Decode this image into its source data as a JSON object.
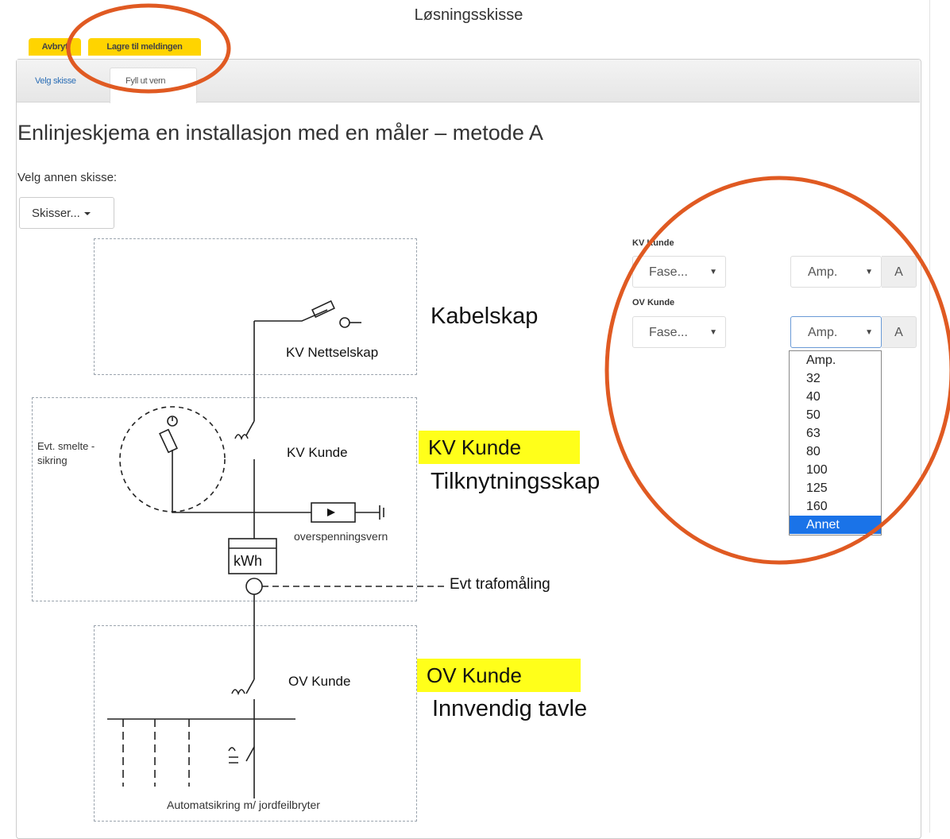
{
  "page_title": "Løsningsskisse",
  "toolbar": {
    "cancel_label": "Avbryt",
    "save_label": "Lagre til meldingen"
  },
  "tabs": [
    {
      "label": "Velg skisse"
    },
    {
      "label": "Fyll ut vern"
    }
  ],
  "heading": "Enlinjeskjema en installasjon med en måler – metode A",
  "choose_other_label": "Velg annen skisse:",
  "sketch_dropdown": {
    "label": "Skisser..."
  },
  "colors": {
    "tab_yellow": "#ffd400",
    "highlight_yellow": "#ffff1a",
    "annotation_orange": "#e05a22",
    "selected_option": "#1a73e8",
    "link_blue": "#2a6db5"
  },
  "form": {
    "kv": {
      "label": "KV Kunde",
      "phase_value": "Fase...",
      "amp_value": "Amp.",
      "unit": "A"
    },
    "ov": {
      "label": "OV Kunde",
      "phase_value": "Fase...",
      "amp_value": "Amp.",
      "unit": "A"
    },
    "amp_options": [
      "Amp.",
      "32",
      "40",
      "50",
      "63",
      "80",
      "100",
      "125",
      "160",
      "Annet"
    ],
    "selected_option": "Annet"
  },
  "diagram": {
    "kabelskap": "Kabelskap",
    "kv_nettselskap": "KV Nettselskap",
    "smelte_sikring": "Evt. smelte - sikring",
    "kv_kunde": "KV Kunde",
    "kv_kunde_highlight": "KV Kunde",
    "tilknytningsskap": "Tilknytningsskap",
    "overspenningsvern": "overspenningsvern",
    "kwh": "kWh",
    "evt_trafomaling": "Evt trafomåling",
    "ov_kunde": "OV Kunde",
    "ov_kunde_highlight": "OV Kunde",
    "innvendig_tavle": "Innvendig tavle",
    "automatsikring": "Automatsikring m/ jordfeilbryter"
  }
}
